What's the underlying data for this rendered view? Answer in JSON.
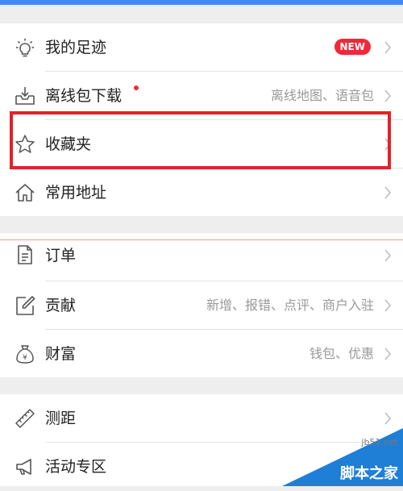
{
  "colors": {
    "accent_blue": "#3d8af7",
    "badge_red": "#f0293a",
    "highlight_red": "#e5202b"
  },
  "menu": {
    "footprint": {
      "label": "我的足迹",
      "badge": "NEW",
      "icon": "lightbulb-icon"
    },
    "offline": {
      "label": "离线包下载",
      "sub": "离线地图、语音包",
      "icon": "download-tray-icon"
    },
    "favorites": {
      "label": "收藏夹",
      "icon": "star-icon"
    },
    "addresses": {
      "label": "常用地址",
      "icon": "home-icon"
    },
    "orders": {
      "label": "订单",
      "icon": "document-icon"
    },
    "contribute": {
      "label": "贡献",
      "sub": "新增、报错、点评、商户入驻",
      "icon": "edit-icon"
    },
    "wealth": {
      "label": "财富",
      "sub": "钱包、优惠",
      "icon": "money-bag-icon"
    },
    "measure": {
      "label": "测距",
      "icon": "ruler-icon"
    },
    "events": {
      "label": "活动专区",
      "icon": "megaphone-icon"
    }
  },
  "watermark": {
    "site": "jb51.net",
    "text": "脚本之家"
  }
}
